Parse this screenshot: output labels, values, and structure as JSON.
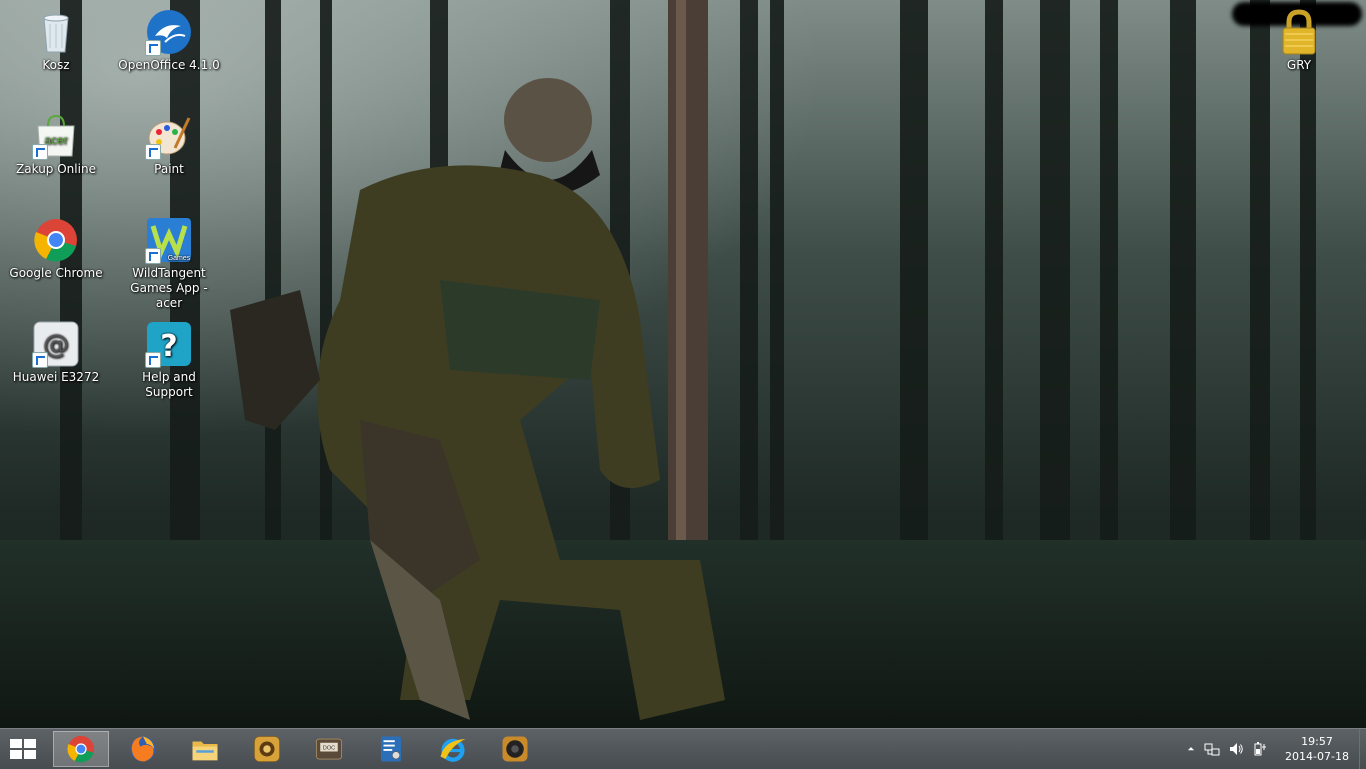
{
  "desktop": {
    "icons": [
      {
        "label": "Kosz",
        "icon": "recycle-bin-icon"
      },
      {
        "label": "OpenOffice 4.1.0",
        "icon": "openoffice-icon"
      },
      {
        "label": "Zakup Online",
        "icon": "acer-shop-icon"
      },
      {
        "label": "Paint",
        "icon": "paint-icon"
      },
      {
        "label": "Google Chrome",
        "icon": "chrome-icon"
      },
      {
        "label": "WildTangent Games App - acer",
        "icon": "wildtangent-icon"
      },
      {
        "label": "Huawei E3272",
        "icon": "huawei-modem-icon"
      },
      {
        "label": "Help and Support",
        "icon": "help-icon"
      },
      {
        "label": "GRY",
        "icon": "lock-folder-icon"
      }
    ]
  },
  "taskbar": {
    "apps": [
      {
        "name": "chrome",
        "icon": "chrome-icon",
        "active": true
      },
      {
        "name": "firefox",
        "icon": "firefox-icon",
        "active": false
      },
      {
        "name": "file-explorer",
        "icon": "folder-icon",
        "active": false
      },
      {
        "name": "app-gold",
        "icon": "gold-app-icon",
        "active": false
      },
      {
        "name": "doc-app",
        "icon": "doc-icon",
        "active": false
      },
      {
        "name": "settings-app",
        "icon": "settings-app-icon",
        "active": false
      },
      {
        "name": "internet-explorer",
        "icon": "ie-icon",
        "active": false
      },
      {
        "name": "speaker-app",
        "icon": "speaker-icon",
        "active": false
      }
    ],
    "clock": {
      "time": "19:57",
      "date": "2014-07-18"
    }
  },
  "colors": {
    "taskbar": "#4f5458",
    "wallpaper": "#1b2420"
  }
}
